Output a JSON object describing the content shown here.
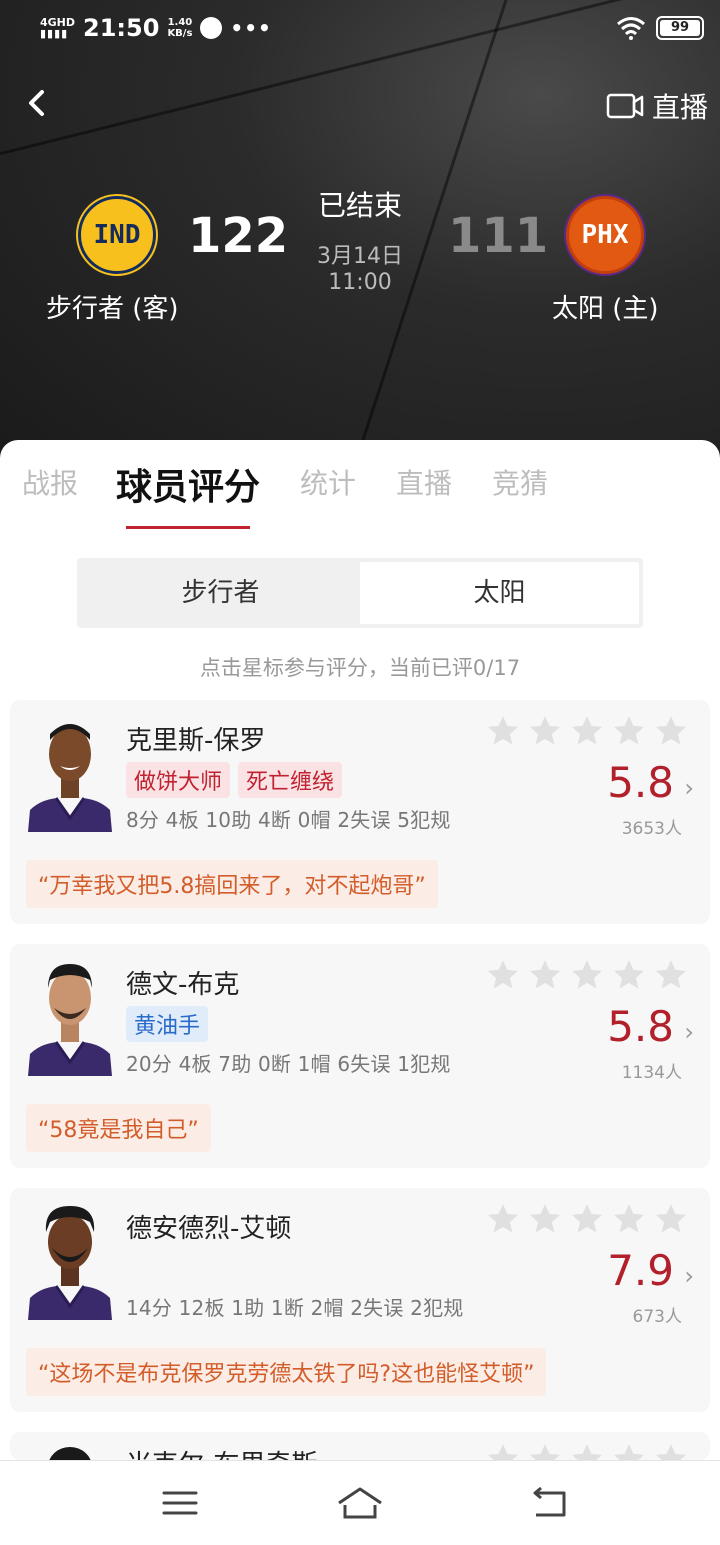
{
  "status_bar": {
    "network": "4GHD",
    "time": "21:50",
    "speed_value": "1.40",
    "speed_unit": "KB/s",
    "dots": "•••",
    "battery": "99"
  },
  "header": {
    "live_label": "直播",
    "away_team": {
      "abbr": "IND",
      "name": "步行者 (客)",
      "score": "122",
      "logo_color": "#f7c01d"
    },
    "home_team": {
      "abbr": "PHX",
      "name": "太阳 (主)",
      "score": "111",
      "logo_color": "#e25a12"
    },
    "state": "已结束",
    "date": "3月14日",
    "time": "11:00"
  },
  "tabs": [
    "战报",
    "球员评分",
    "统计",
    "直播",
    "竞猜"
  ],
  "active_tab": "球员评分",
  "segment": {
    "left": "步行者",
    "right": "太阳",
    "selected": "太阳"
  },
  "hint": "点击星标参与评分，当前已评0/17",
  "players": [
    {
      "name": "克里斯-保罗",
      "tags": [
        {
          "text": "做饼大师",
          "color": "red"
        },
        {
          "text": "死亡缠绕",
          "color": "red"
        }
      ],
      "stats": "8分  4板  10助  4断  0帽  2失误  5犯规",
      "rating": "5.8",
      "voters": "3653人",
      "quote": "“万幸我又把5.8搞回来了，对不起炮哥”"
    },
    {
      "name": "德文-布克",
      "tags": [
        {
          "text": "黄油手",
          "color": "blue"
        }
      ],
      "stats": "20分  4板  7助  0断  1帽  6失误  1犯规",
      "rating": "5.8",
      "voters": "1134人",
      "quote": "“58竟是我自己”"
    },
    {
      "name": "德安德烈-艾顿",
      "tags": [],
      "stats": "14分  12板  1助  1断  2帽  2失误  2犯规",
      "rating": "7.9",
      "voters": "673人",
      "quote": "“这场不是布克保罗克劳德太铁了吗?这也能怪艾顿”"
    },
    {
      "name": "米克尔-布里奇斯"
    }
  ],
  "colors": {
    "accent": "#b2202c",
    "tag_red": "#c0232f",
    "tag_blue": "#2a6ac9",
    "quote": "#d35d2a"
  },
  "icons": {
    "back": "chevron-left-icon",
    "live": "video-camera-icon",
    "star": "star-icon",
    "nav": [
      "menu-icon",
      "home-icon",
      "back-icon"
    ]
  }
}
